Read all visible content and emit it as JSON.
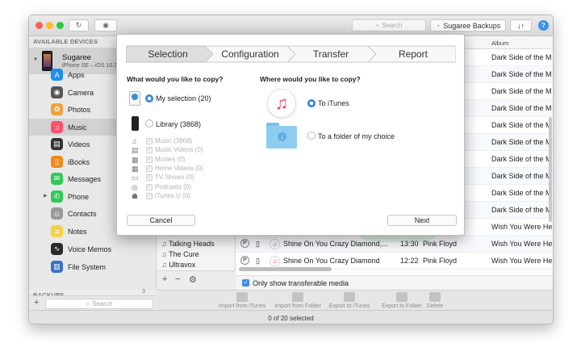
{
  "window": {
    "search_placeholder": "Search",
    "backups_button": "Sugaree Backups",
    "transfer_button": "↓↑",
    "help": "?"
  },
  "sidebar": {
    "available_devices": "AVAILABLE DEVICES",
    "device_name": "Sugaree",
    "device_sub": "iPhone SE – iOS 10.3",
    "items": [
      {
        "label": "Apps",
        "color": "#1b8ef5",
        "glyph": "A"
      },
      {
        "label": "Camera",
        "color": "#555555",
        "glyph": "◉"
      },
      {
        "label": "Photos",
        "color": "#f2a23a",
        "glyph": "✿"
      },
      {
        "label": "Music",
        "color": "#ff4f6a",
        "glyph": "♫"
      },
      {
        "label": "Videos",
        "color": "#333333",
        "glyph": "▤"
      },
      {
        "label": "iBooks",
        "color": "#f08a1c",
        "glyph": "▯"
      },
      {
        "label": "Messages",
        "color": "#33c759",
        "glyph": "✉"
      },
      {
        "label": "Phone",
        "color": "#33c759",
        "glyph": "✆"
      },
      {
        "label": "Contacts",
        "color": "#9a9a9a",
        "glyph": "☺"
      },
      {
        "label": "Notes",
        "color": "#f6d24a",
        "glyph": "≡"
      },
      {
        "label": "Voice Memos",
        "color": "#2b2b2b",
        "glyph": "∿"
      },
      {
        "label": "File System",
        "color": "#3a71c6",
        "glyph": "▥"
      }
    ],
    "backups": "BACKUPS",
    "backups_count": "3",
    "add": "+",
    "search_placeholder": "Search"
  },
  "artists": [
    "Talking Heads",
    "The Cure",
    "Ultravox"
  ],
  "artist_controls": {
    "add": "+",
    "remove": "−",
    "settings": "⚙"
  },
  "table": {
    "album_header": "Album",
    "album_rows": [
      "Dark Side of the M",
      "Dark Side of the M",
      "Dark Side of the M",
      "Dark Side of the M",
      "Dark Side of the M",
      "Dark Side of the M",
      "Dark Side of the M",
      "Dark Side of the M",
      "Dark Side of the M",
      "Dark Side of the M",
      "Wish You Were He"
    ],
    "track_rows": [
      {
        "title": "Shine On You Crazy Diamond,...",
        "time": "13:30",
        "artist": "Pink Floyd",
        "album": "Wish You Were He"
      },
      {
        "title": "Shine On You Crazy Diamond",
        "time": "12:22",
        "artist": "Pink Floyd",
        "album": "Wish You Were He"
      }
    ],
    "only_transferable": "Only show transferable media"
  },
  "actions": [
    {
      "label": "Import from iTunes"
    },
    {
      "label": "Import from Folder"
    },
    {
      "label": "Export to iTunes"
    },
    {
      "label": "Export to Folder"
    },
    {
      "label": "Delete"
    }
  ],
  "status": "0 of 20 selected",
  "dialog": {
    "steps": [
      "Selection",
      "Configuration",
      "Transfer",
      "Report"
    ],
    "left_question": "What would you like to copy?",
    "right_question": "Where would you like to copy?",
    "my_selection": "My selection (20)",
    "library": "Library (3868)",
    "library_items": [
      "Music (3868)",
      "Music Videos (0)",
      "Movies (0)",
      "Home Videos (0)",
      "TV Shows (0)",
      "Podcasts (0)",
      "iTunes U (0)"
    ],
    "to_itunes": "To iTunes",
    "to_folder": "To a folder of my choice",
    "cancel": "Cancel",
    "next": "Next"
  }
}
